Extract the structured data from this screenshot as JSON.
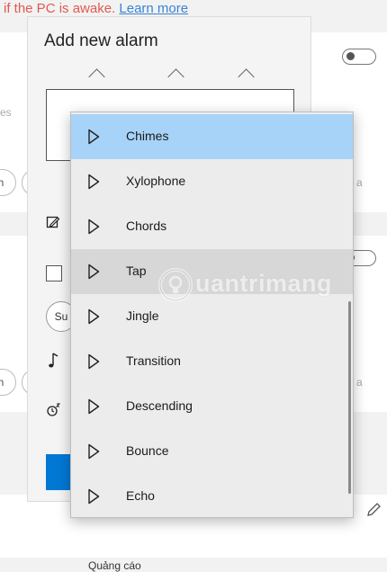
{
  "header_note": {
    "text": "if the PC is awake.",
    "link": "Learn more"
  },
  "background": {
    "left_fragments": [
      "es",
      "h",
      "Su",
      "h"
    ],
    "right_fragments": [
      "a",
      "a"
    ]
  },
  "dialog": {
    "title": "Add new alarm"
  },
  "sound_list": {
    "items": [
      {
        "label": "Chimes",
        "state": "selected"
      },
      {
        "label": "Xylophone",
        "state": "normal"
      },
      {
        "label": "Chords",
        "state": "normal"
      },
      {
        "label": "Tap",
        "state": "hover"
      },
      {
        "label": "Jingle",
        "state": "normal"
      },
      {
        "label": "Transition",
        "state": "normal"
      },
      {
        "label": "Descending",
        "state": "normal"
      },
      {
        "label": "Bounce",
        "state": "normal"
      },
      {
        "label": "Echo",
        "state": "normal"
      }
    ]
  },
  "watermark": {
    "text": "uantrimang"
  },
  "footer": {
    "ad_label": "Quảng cáo"
  },
  "colors": {
    "accent": "#0078d4",
    "selected": "#a8d3f8",
    "hover": "#d7d7d7",
    "warning_text": "#e05a4e",
    "link": "#3a83d6"
  }
}
